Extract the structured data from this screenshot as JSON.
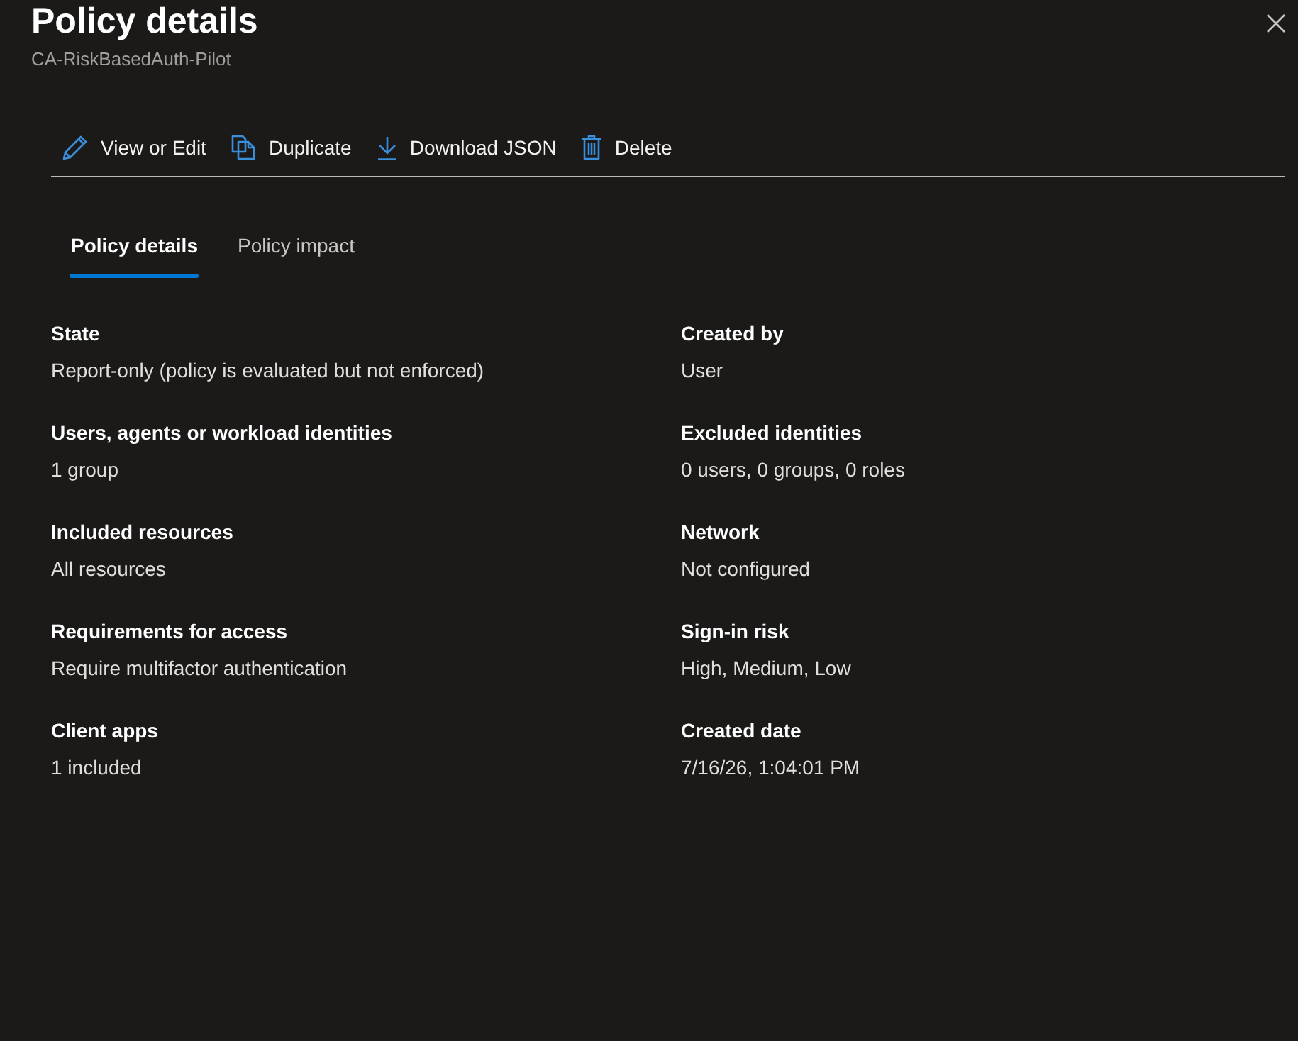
{
  "panel": {
    "title": "Policy details",
    "subtitle": "CA-RiskBasedAuth-Pilot"
  },
  "toolbar": [
    {
      "kind": "edit",
      "label": "View or Edit"
    },
    {
      "kind": "duplicate",
      "label": "Duplicate"
    },
    {
      "kind": "download",
      "label": "Download JSON"
    },
    {
      "kind": "delete",
      "label": "Delete"
    }
  ],
  "tabs": [
    {
      "label": "Policy details",
      "selected": true
    },
    {
      "label": "Policy impact",
      "selected": false
    }
  ],
  "details": [
    {
      "label": "State",
      "value": "Report-only (policy is evaluated but not enforced)"
    },
    {
      "label": "Created by",
      "value": "User"
    },
    {
      "label": "Users, agents or workload identities",
      "value": "1 group"
    },
    {
      "label": "Excluded identities",
      "value": "0 users, 0 groups, 0 roles"
    },
    {
      "label": "Included resources",
      "value": "All resources"
    },
    {
      "label": "Network",
      "value": "Not configured"
    },
    {
      "label": "Requirements for access",
      "value": "Require multifactor authentication"
    },
    {
      "label": "Sign-in risk",
      "value": "High, Medium, Low"
    },
    {
      "label": "Client apps",
      "value": "1 included"
    },
    {
      "label": "Created date",
      "value": "7/16/26, 1:04:01 PM"
    }
  ]
}
